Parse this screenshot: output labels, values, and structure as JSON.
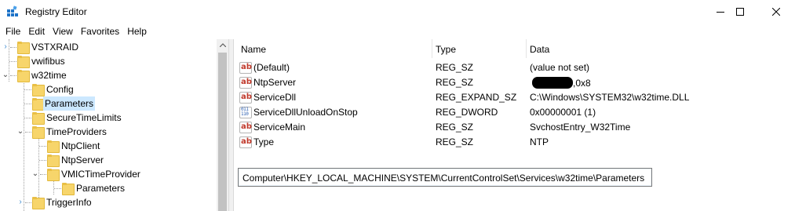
{
  "window": {
    "title": "Registry Editor",
    "controls": {
      "minimize_icon": "minimize-icon",
      "maximize_icon": "maximize-icon",
      "close_icon": "close-icon"
    }
  },
  "menu": [
    "File",
    "Edit",
    "View",
    "Favorites",
    "Help"
  ],
  "tree": {
    "items": [
      {
        "label": "VSTXRAID",
        "expander": "›",
        "level": 0,
        "selected": false
      },
      {
        "label": "vwifibus",
        "expander": "",
        "level": 0,
        "selected": false
      },
      {
        "label": "w32time",
        "expander": "⌄",
        "level": 0,
        "selected": false
      },
      {
        "label": "Config",
        "expander": "",
        "level": 1,
        "selected": false
      },
      {
        "label": "Parameters",
        "expander": "",
        "level": 1,
        "selected": true
      },
      {
        "label": "SecureTimeLimits",
        "expander": "",
        "level": 1,
        "selected": false
      },
      {
        "label": "TimeProviders",
        "expander": "⌄",
        "level": 1,
        "selected": false
      },
      {
        "label": "NtpClient",
        "expander": "",
        "level": 2,
        "selected": false
      },
      {
        "label": "NtpServer",
        "expander": "",
        "level": 2,
        "selected": false
      },
      {
        "label": "VMICTimeProvider",
        "expander": "⌄",
        "level": 2,
        "selected": false
      },
      {
        "label": "Parameters",
        "expander": "",
        "level": 3,
        "selected": false
      },
      {
        "label": "TriggerInfo",
        "expander": "›",
        "level": 1,
        "selected": false
      }
    ]
  },
  "list": {
    "columns": {
      "name": "Name",
      "type": "Type",
      "data": "Data"
    },
    "rows": [
      {
        "icon": "string-value-icon",
        "name": "(Default)",
        "type": "REG_SZ",
        "data": "(value not set)",
        "redacted": false
      },
      {
        "icon": "string-value-icon",
        "name": "NtpServer",
        "type": "REG_SZ",
        "data": ",0x8",
        "redacted": true
      },
      {
        "icon": "string-value-icon",
        "name": "ServiceDll",
        "type": "REG_EXPAND_SZ",
        "data": "C:\\Windows\\SYSTEM32\\w32time.DLL",
        "redacted": false
      },
      {
        "icon": "binary-value-icon",
        "name": "ServiceDllUnloadOnStop",
        "type": "REG_DWORD",
        "data": "0x00000001 (1)",
        "redacted": false
      },
      {
        "icon": "string-value-icon",
        "name": "ServiceMain",
        "type": "REG_SZ",
        "data": "SvchostEntry_W32Time",
        "redacted": false
      },
      {
        "icon": "string-value-icon",
        "name": "Type",
        "type": "REG_SZ",
        "data": "NTP",
        "redacted": false
      }
    ]
  },
  "address": {
    "path": "Computer\\HKEY_LOCAL_MACHINE\\SYSTEM\\CurrentControlSet\\Services\\w32time\\Parameters"
  }
}
